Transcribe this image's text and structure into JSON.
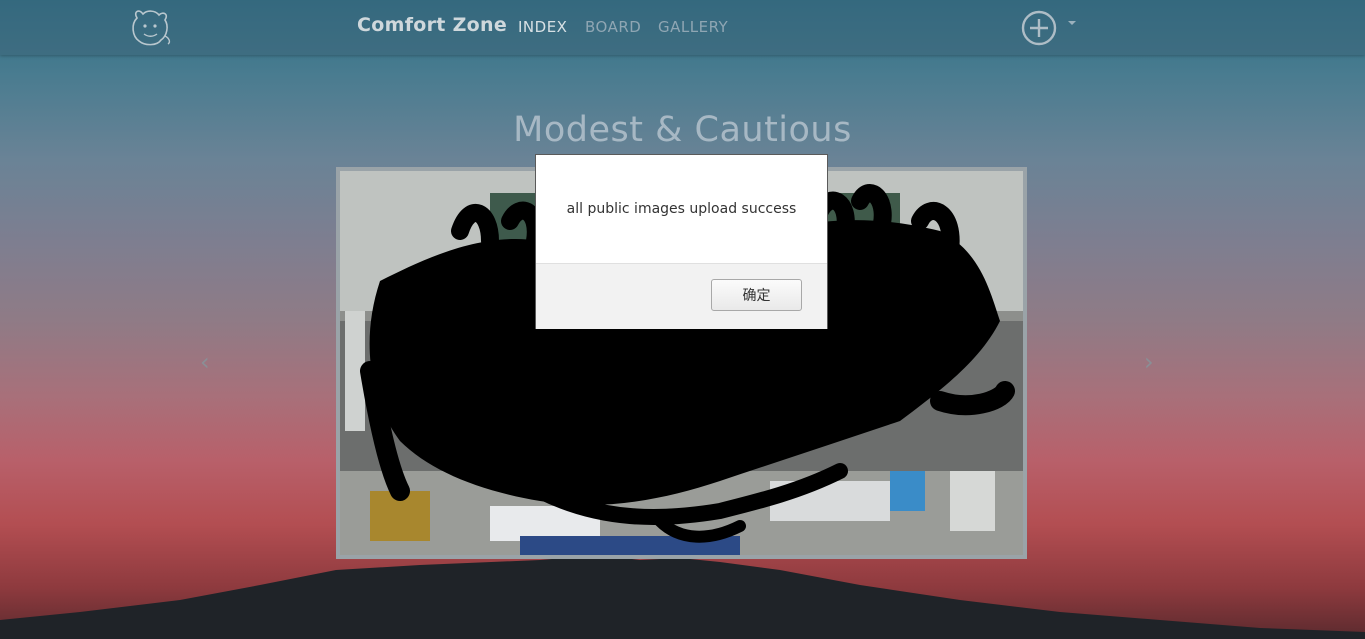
{
  "navbar": {
    "brand": "Comfort Zone",
    "links": [
      {
        "label": "INDEX",
        "active": true
      },
      {
        "label": "BOARD",
        "active": false
      },
      {
        "label": "GALLERY",
        "active": false
      }
    ],
    "add_icon": "plus-circle-icon",
    "logo_icon": "creature-doodle-logo"
  },
  "main": {
    "heading": "Modest & Cautious",
    "carousel": {
      "prev_label": "‹",
      "next_label": "›",
      "image": "classroom-photo-redacted"
    }
  },
  "dialog": {
    "message": "all public images upload success",
    "ok_label": "确定"
  },
  "colors": {
    "sky_top": "#2c6f86",
    "sky_bottom": "#b34e52",
    "navbar": "#3c6478",
    "heading": "#a7b8c4"
  }
}
